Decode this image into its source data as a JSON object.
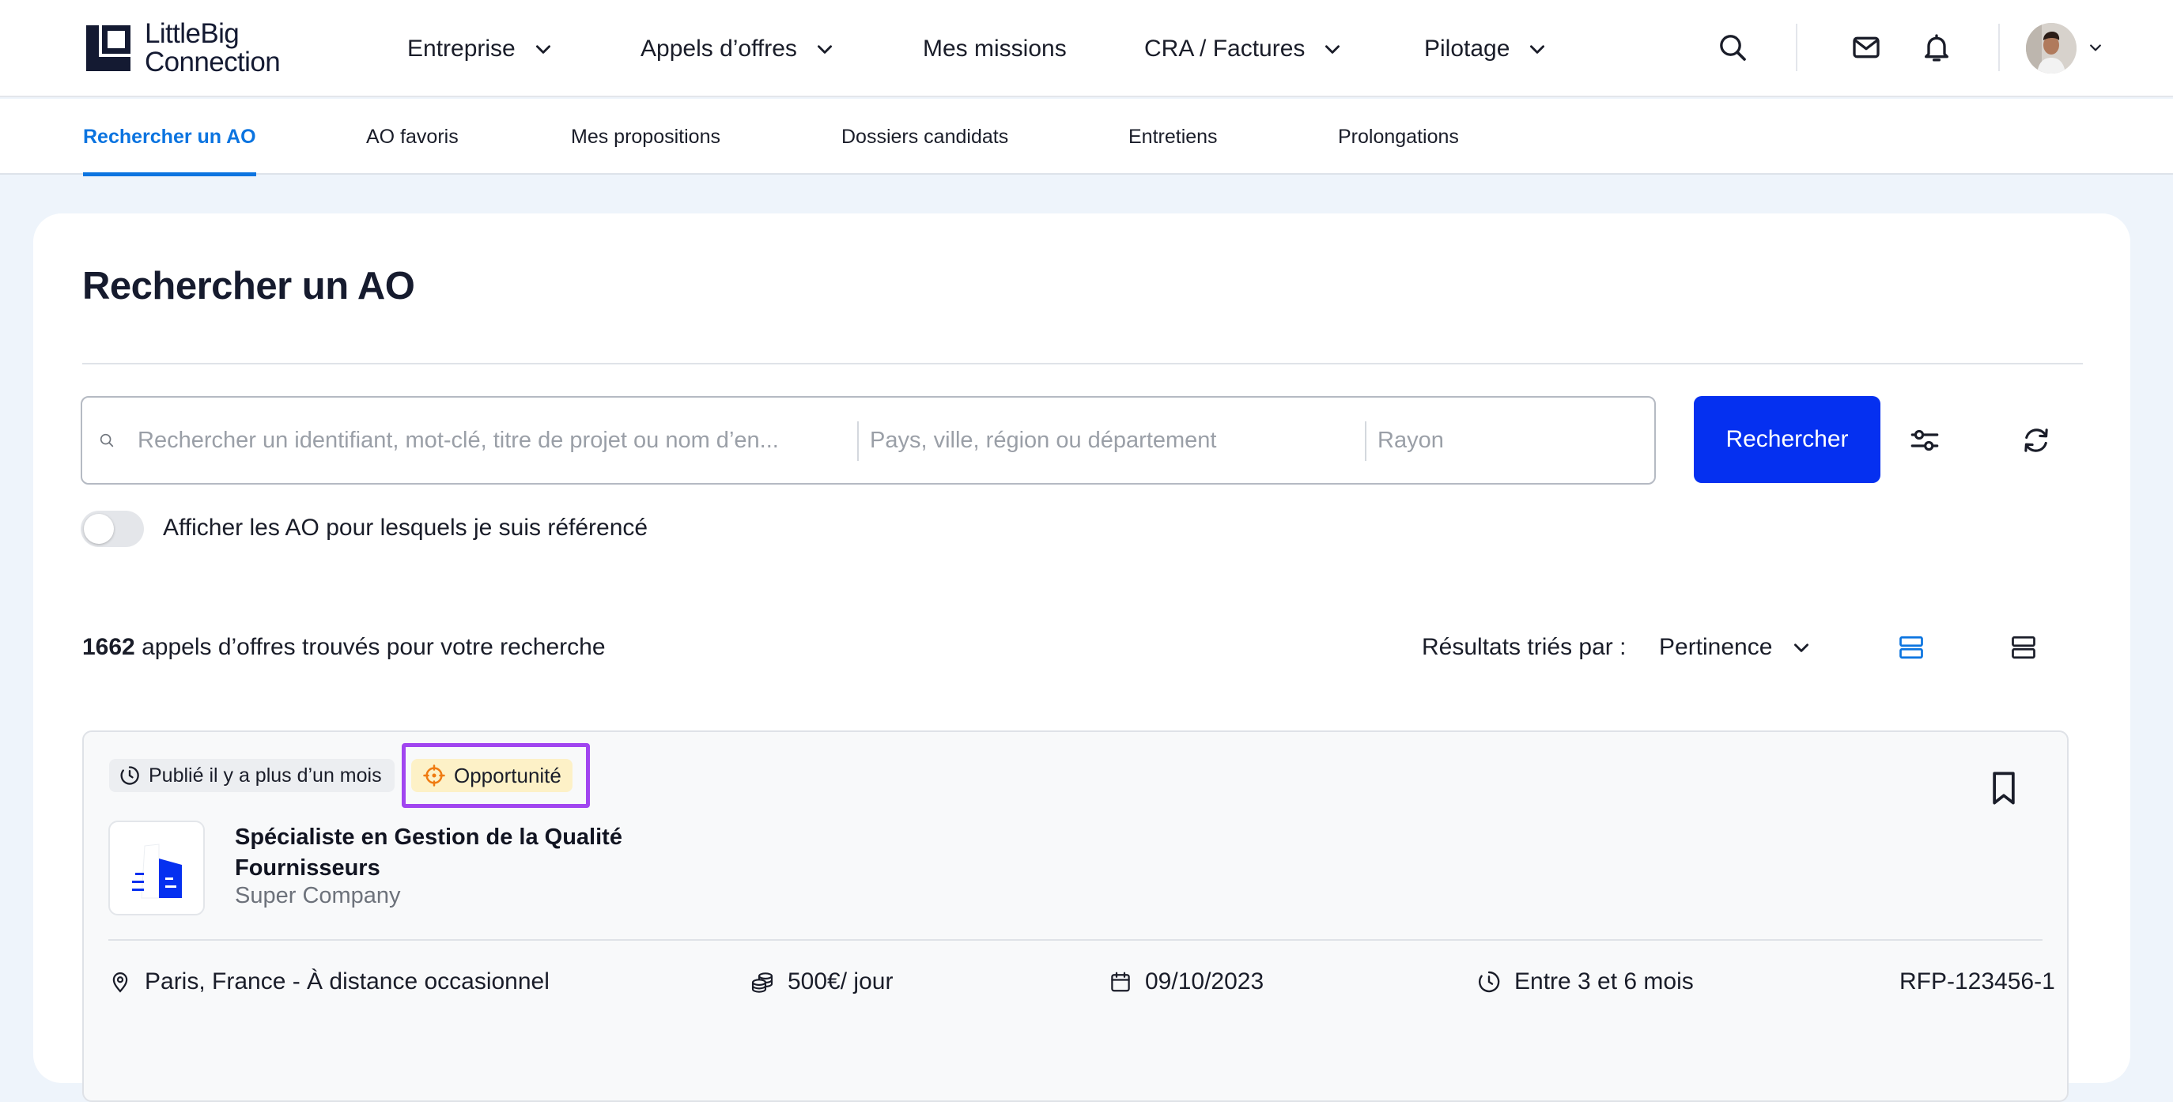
{
  "brand": {
    "line1": "LittleBig",
    "line2": "Connection"
  },
  "nav": {
    "items": [
      {
        "label": "Entreprise"
      },
      {
        "label": "Appels d’offres"
      },
      {
        "label": "Mes missions"
      },
      {
        "label": "CRA / Factures"
      },
      {
        "label": "Pilotage"
      }
    ]
  },
  "subnav": {
    "items": [
      {
        "label": "Rechercher un AO"
      },
      {
        "label": "AO favoris"
      },
      {
        "label": "Mes propositions"
      },
      {
        "label": "Dossiers candidats"
      },
      {
        "label": "Entretiens"
      },
      {
        "label": "Prolongations"
      }
    ],
    "active_index": 0
  },
  "page": {
    "title": "Rechercher un AO"
  },
  "search": {
    "keyword_placeholder": "Rechercher un identifiant, mot-clé, titre de projet ou nom d’en...",
    "location_placeholder": "Pays, ville, région ou département",
    "radius_placeholder": "Rayon",
    "submit_label": "Rechercher"
  },
  "toggle": {
    "label": "Afficher les AO pour lesquels je suis référencé",
    "on": false
  },
  "results": {
    "count": "1662",
    "count_suffix": "appels d’offres trouvés pour votre recherche",
    "sort_label": "Résultats triés par :",
    "sort_value": "Pertinence"
  },
  "result_card": {
    "published_badge": "Publié il y a plus d’un mois",
    "opportunity_badge": "Opportunité",
    "title": "Spécialiste en Gestion de la Qualité Fournisseurs",
    "company": "Super Company",
    "location": "Paris, France - À distance occasionnel",
    "rate": "500€/ jour",
    "start_date": "09/10/2023",
    "duration": "Entre 3 et 6 mois",
    "reference": "RFP-123456-1"
  },
  "colors": {
    "primary": "#0530f0",
    "active_tab": "#0b74e0",
    "highlight": "#a145f0",
    "opportunity_bg": "#fdf1c7",
    "page_bg": "#eef4fb"
  }
}
